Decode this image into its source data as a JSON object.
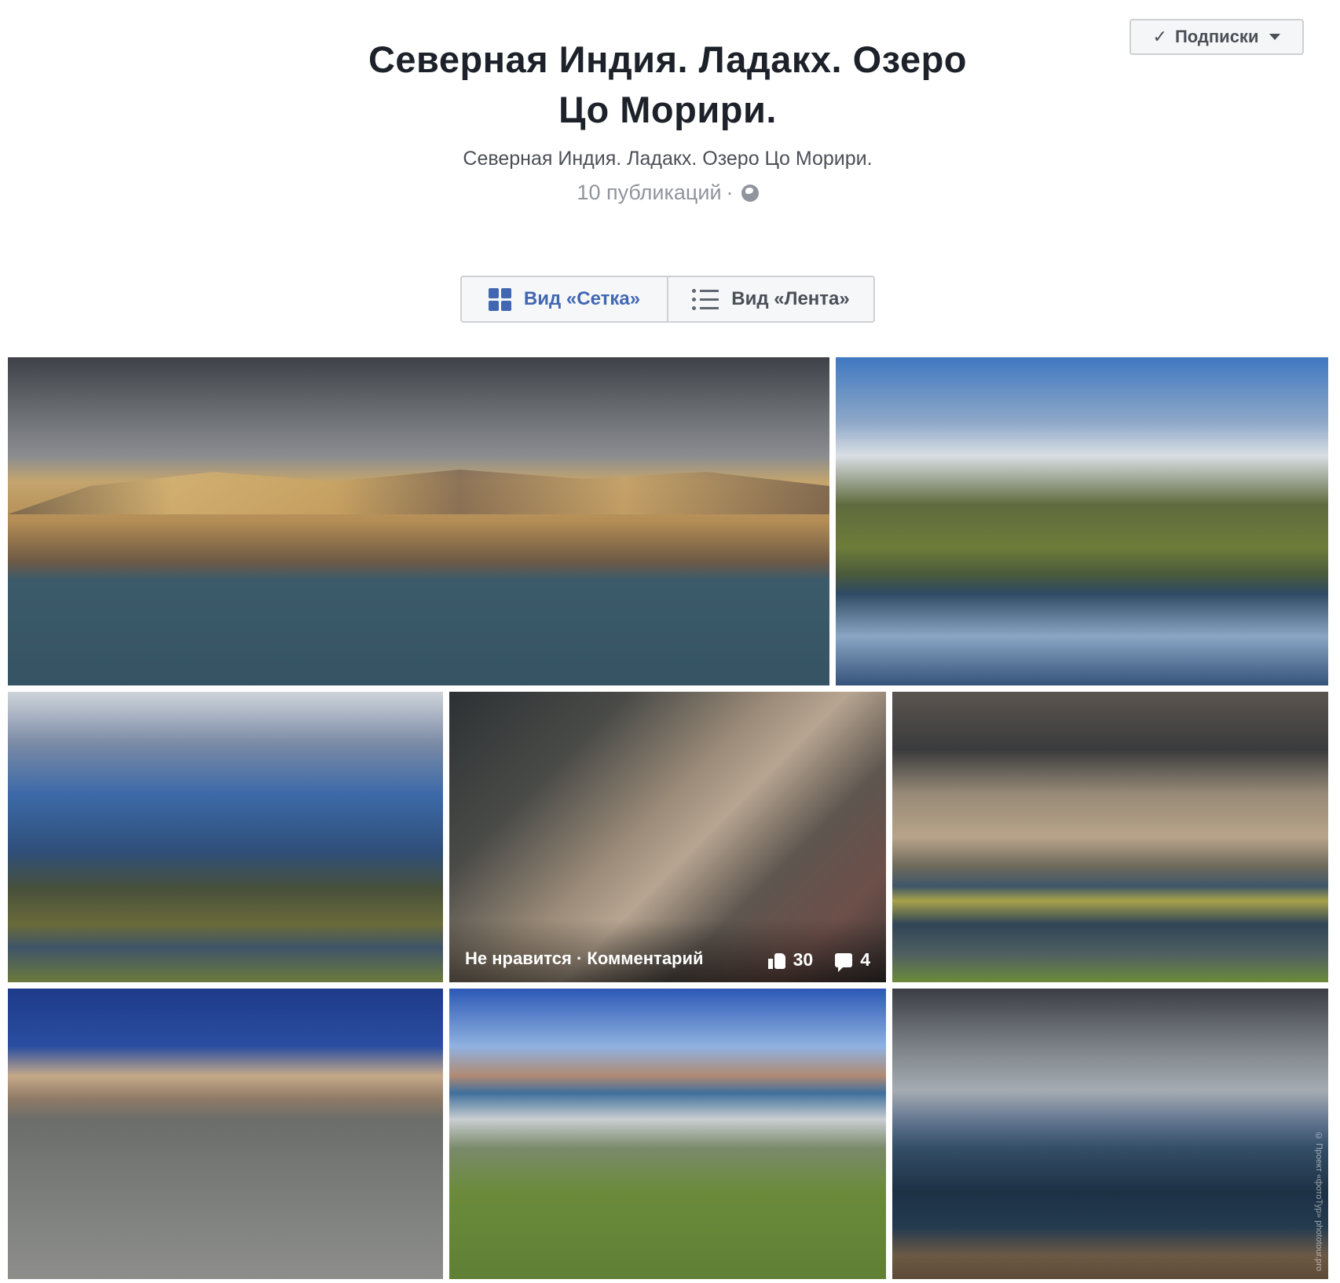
{
  "header": {
    "subscribe_label": "Подписки",
    "title_line1": "Северная Индия. Ладакх. Озеро",
    "title_line2": "Цо Морири.",
    "description": "Северная Индия. Ладакх. Озеро Цо Морири.",
    "publications": "10 публикаций",
    "meta_separator": "·",
    "privacy_icon": "globe-icon"
  },
  "view_toggle": {
    "grid_label": "Вид «Сетка»",
    "feed_label": "Вид «Лента»",
    "active": "grid"
  },
  "photos": {
    "hover": {
      "unlike_label": "Не нравится",
      "separator": "·",
      "comment_label": "Комментарий",
      "likes": "30",
      "comments": "4"
    },
    "watermark": "© Проект «фотоТур» phototour.pro"
  },
  "colors": {
    "accent": "#4267b2",
    "title": "#1d2129",
    "muted": "#90949c"
  }
}
